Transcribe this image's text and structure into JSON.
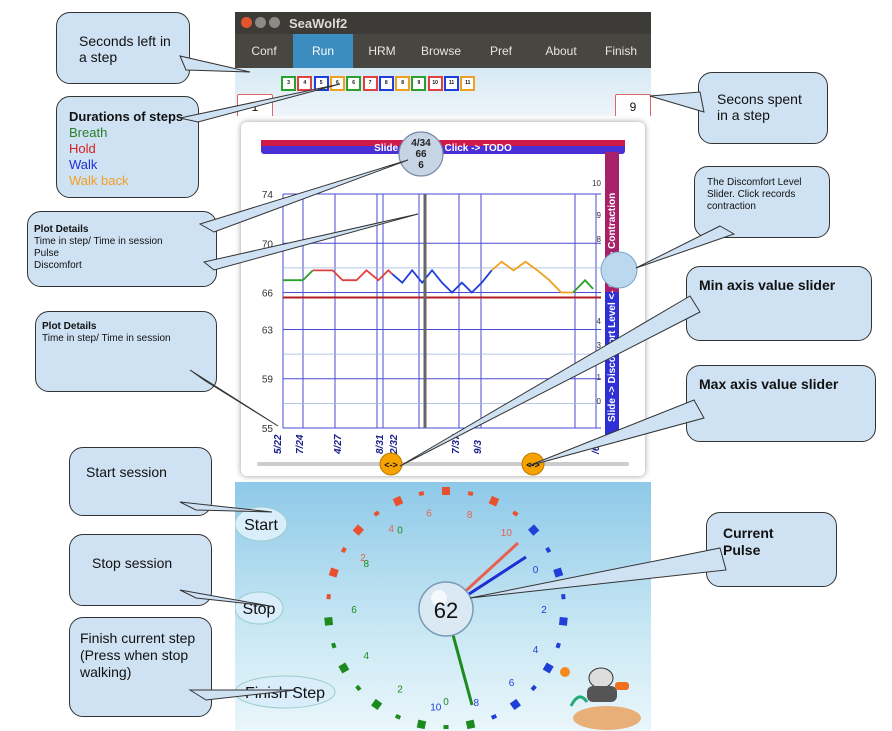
{
  "window": {
    "title": "SeaWolf2"
  },
  "menu": {
    "items": [
      "Conf",
      "Run",
      "HRM",
      "Browse",
      "Pref",
      "About",
      "Finish"
    ],
    "active": "Run"
  },
  "steps": [
    {
      "n": "3",
      "color": "#2ca02c"
    },
    {
      "n": "4",
      "color": "#e04040"
    },
    {
      "n": "5",
      "color": "#1f3fd6"
    },
    {
      "n": "6",
      "color": "#f0a020"
    },
    {
      "n": "6",
      "color": "#2ca02c"
    },
    {
      "n": "7",
      "color": "#e04040"
    },
    {
      "n": "8",
      "color": "#1f3fd6"
    },
    {
      "n": "8",
      "color": "#f0a020"
    },
    {
      "n": "9",
      "color": "#2ca02c"
    },
    {
      "n": "10",
      "color": "#e04040"
    },
    {
      "n": "11",
      "color": "#1f3fd6"
    },
    {
      "n": "11",
      "color": "#f0a020"
    }
  ],
  "counters": {
    "seconds_left": "1",
    "seconds_spent": "9"
  },
  "chart": {
    "banner": "Slide -> sho      s, Click -> TODO",
    "bubble": [
      "4/34",
      "66",
      "6"
    ],
    "side_label": "Slide -> Discomfort Level <- Click -> Contraction",
    "y_ticks": [
      "74",
      "70",
      "66",
      "63",
      "59",
      "55"
    ],
    "right_ticks": [
      "10",
      "9",
      "8",
      "4",
      "3",
      "1",
      "0"
    ],
    "x_labels": [
      "5/22",
      "7/24",
      "4/27",
      "8/31",
      "2/32",
      "7/37",
      "9/3",
      "/64"
    ],
    "slider_thumb": "<->"
  },
  "chart_data": {
    "type": "line",
    "ylim": [
      55,
      74
    ],
    "yticks": [
      74,
      70,
      66,
      63,
      59,
      55
    ],
    "series": [
      {
        "color": "#2ca02c",
        "values": [
          [
            0,
            67
          ],
          [
            1,
            67
          ],
          [
            1.5,
            67.8
          ]
        ]
      },
      {
        "color": "#e04040",
        "values": [
          [
            1.5,
            67.8
          ],
          [
            2.5,
            67.8
          ],
          [
            3,
            67
          ],
          [
            3.7,
            67
          ],
          [
            4.2,
            67.8
          ],
          [
            4.8,
            67
          ],
          [
            5.3,
            67.8
          ],
          [
            5.5,
            67.5
          ]
        ]
      },
      {
        "color": "#1f3fd6",
        "values": [
          [
            5.5,
            67.5
          ],
          [
            6,
            66.8
          ],
          [
            6.5,
            67.8
          ],
          [
            7,
            66.8
          ],
          [
            7.5,
            67.8
          ],
          [
            8,
            66.8
          ],
          [
            8.5,
            66
          ],
          [
            9,
            66.8
          ],
          [
            9.5,
            66
          ],
          [
            10,
            66.8
          ],
          [
            10.5,
            67.8
          ]
        ]
      },
      {
        "color": "#f0a020",
        "values": [
          [
            10.5,
            67.8
          ],
          [
            11,
            68.5
          ],
          [
            11.6,
            67.8
          ],
          [
            12.2,
            68.5
          ],
          [
            12.8,
            67.8
          ],
          [
            13.4,
            67
          ],
          [
            14,
            66
          ],
          [
            14.6,
            66
          ]
        ]
      },
      {
        "color": "#2ca02c",
        "values": [
          [
            14.6,
            66
          ],
          [
            15.2,
            67
          ],
          [
            15.6,
            66.3
          ]
        ]
      }
    ],
    "baseline": {
      "color": "#b02020",
      "value": 65.6
    }
  },
  "dial": {
    "pulse": "62",
    "green_labels": [
      "0",
      "2",
      "4",
      "6",
      "8",
      "0"
    ],
    "red_labels": [
      "2",
      "4",
      "6",
      "8",
      "10"
    ],
    "blue_labels": [
      "0",
      "2",
      "4",
      "6",
      "8",
      "10"
    ]
  },
  "buttons": {
    "start": "Start",
    "stop": "Stop",
    "finish_step": "Finish Step"
  },
  "callouts": {
    "seconds_left": "Seconds left in a step",
    "durations_title": "Durations of steps",
    "breath": "Breath",
    "hold": "Hold",
    "walk": "Walk",
    "walk_back": "Walk back",
    "plot_details_title": "Plot Details",
    "plot_details_1": [
      "Time in step/ Time in session",
      "Pulse",
      "Discomfort"
    ],
    "plot_details_2": [
      "Time in step/ Time in session"
    ],
    "seconds_spent": "Secons spent in a step",
    "discomfort": "The Discomfort Level Slider. Click records contraction",
    "min_axis": "Min axis value slider",
    "max_axis": "Max axis value slider",
    "start": "Start session",
    "stop": "Stop session",
    "finish": "Finish current step (Press when stop walking)",
    "pulse": "Current Pulse"
  }
}
